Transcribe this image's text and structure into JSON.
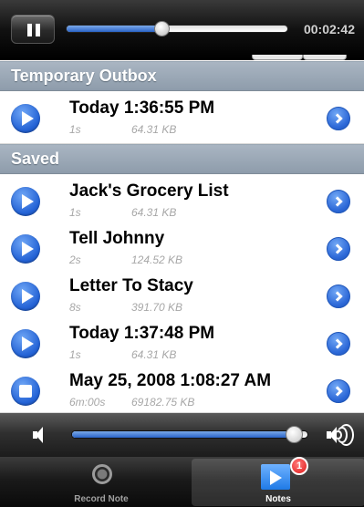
{
  "player": {
    "elapsed": "00:02:42",
    "progress_fraction": 0.43
  },
  "sections": [
    {
      "header": "Temporary Outbox",
      "rows": [
        {
          "title": "Today 1:36:55 PM",
          "duration": "1s",
          "size": "64.31 KB",
          "state": "play"
        }
      ]
    },
    {
      "header": "Saved",
      "rows": [
        {
          "title": "Jack's Grocery List",
          "duration": "1s",
          "size": "64.31 KB",
          "state": "play"
        },
        {
          "title": "Tell Johnny",
          "duration": "2s",
          "size": "124.52 KB",
          "state": "play"
        },
        {
          "title": "Letter To Stacy",
          "duration": "8s",
          "size": "391.70 KB",
          "state": "play"
        },
        {
          "title": "Today 1:37:48 PM",
          "duration": "1s",
          "size": "64.31 KB",
          "state": "play"
        },
        {
          "title": "May 25, 2008 1:08:27 AM",
          "duration": "6m:00s",
          "size": "69182.75 KB",
          "state": "stop"
        }
      ]
    }
  ],
  "volume": {
    "level_fraction": 0.94
  },
  "tabs": {
    "record": {
      "label": "Record Note",
      "icon": "record-icon"
    },
    "notes": {
      "label": "Notes",
      "icon": "notes-icon",
      "badge": "1",
      "selected": true
    }
  },
  "colors": {
    "accent": "#2a64c8",
    "section_header": "#9aa7b4",
    "badge": "#e01818"
  }
}
